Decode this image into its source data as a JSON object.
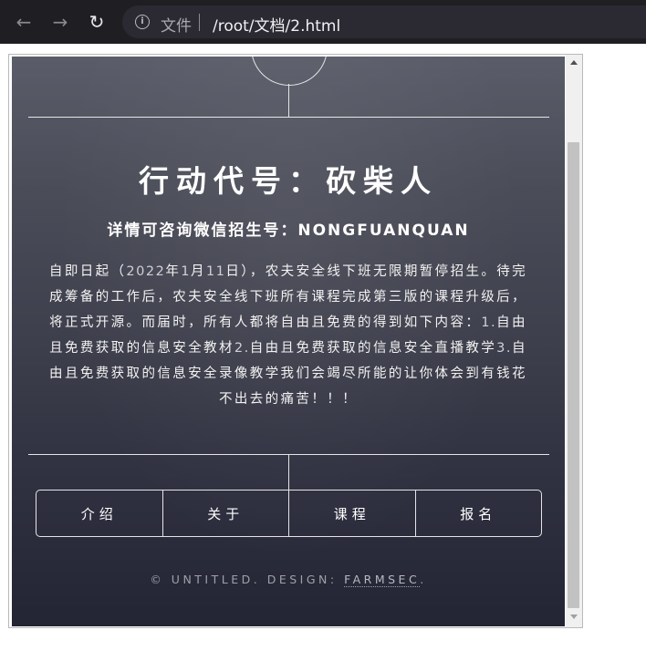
{
  "browser": {
    "back_icon": "←",
    "forward_icon": "→",
    "reload_icon": "↻",
    "info_icon": "i",
    "scheme_label": "文件",
    "url": "/root/文档/2.html"
  },
  "page": {
    "title": "行动代号：砍柴人",
    "subtitle": "详情可咨询微信招生号：NONGFUANQUAN",
    "body": [
      {
        "text": "自即日起（",
        "num": false
      },
      {
        "text": "2022",
        "num": true
      },
      {
        "text": "年",
        "num": false
      },
      {
        "text": "1",
        "num": true
      },
      {
        "text": "月",
        "num": false
      },
      {
        "text": "11",
        "num": true
      },
      {
        "text": "日），农夫安全线下班无限期暂停招生。待完成筹备的工作后，农夫安全线下班所有课程完成第三版的课程升级后，将正式开源。而届时，所有人都将自由且免费的得到如下内容：",
        "num": false
      },
      {
        "text": "1.",
        "num": true
      },
      {
        "text": "自由且免费获取的信息安全教材",
        "num": false
      },
      {
        "text": "2.",
        "num": true
      },
      {
        "text": "自由且免费获取的信息安全直播教学",
        "num": false
      },
      {
        "text": "3.",
        "num": true
      },
      {
        "text": "自由且免费获取的信息安全录像教学我们会竭尽所能的让你体会到有钱花不出去的痛苦！！！",
        "num": false
      }
    ],
    "nav": [
      "介绍",
      "关于",
      "课程",
      "报名"
    ],
    "footer_prefix": "© UNTITLED. DESIGN: ",
    "footer_link": "FARMSEC",
    "footer_suffix": "."
  },
  "colors": {
    "chrome_bg": "#1f1f23",
    "url_bar_bg": "#2b2a33",
    "page_bg_top": "#5a5d69",
    "page_bg_bottom": "#232434",
    "text": "#ffffff"
  }
}
